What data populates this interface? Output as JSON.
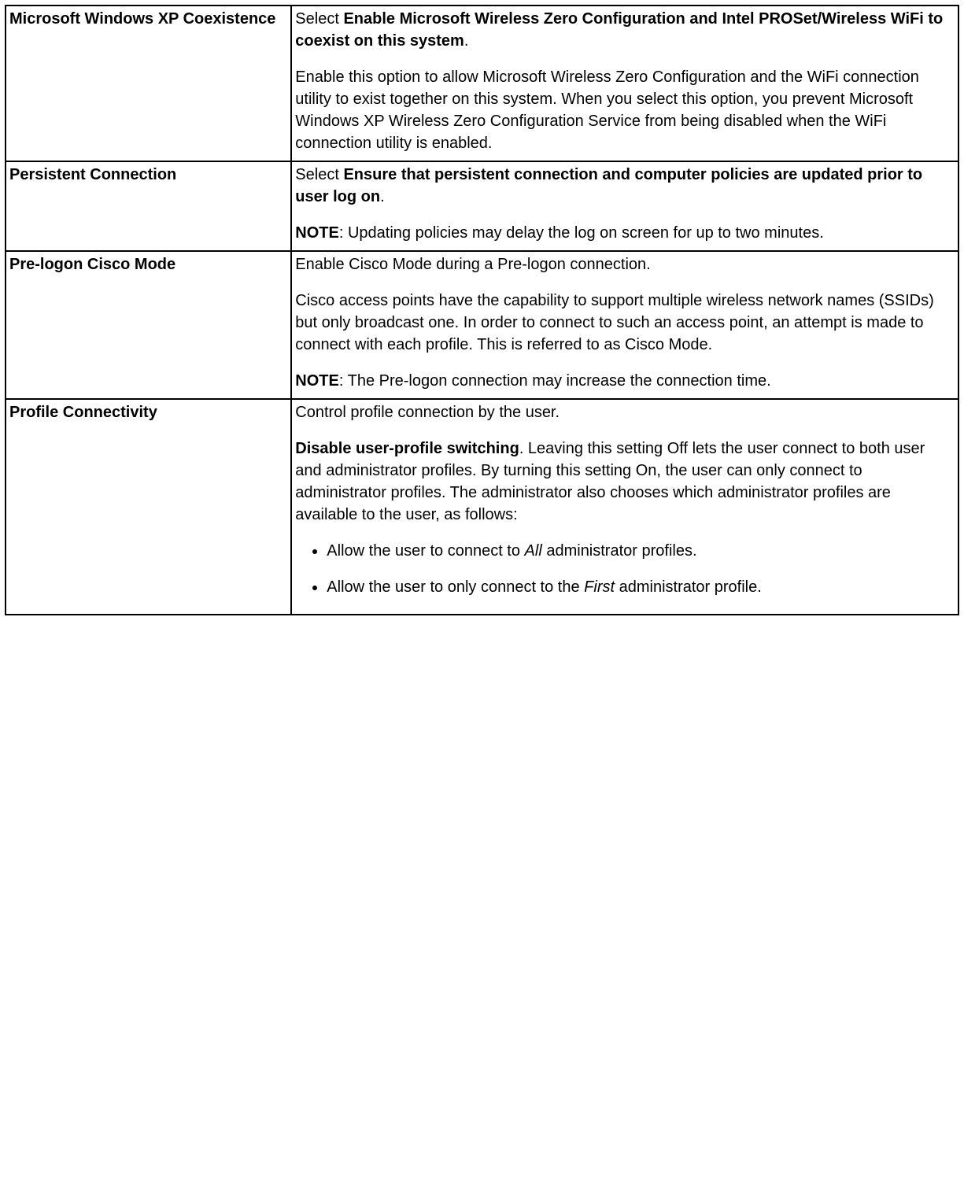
{
  "rows": [
    {
      "label": "Microsoft Windows XP Coexistence",
      "intro_pre": "Select ",
      "intro_bold": "Enable Microsoft Wireless Zero Configuration and Intel PROSet/Wireless WiFi to coexist on this system",
      "intro_post": ".",
      "body": "Enable this option to allow Microsoft Wireless Zero Configuration and the WiFi connection utility to exist together on this system. When you select this option, you prevent Microsoft Windows XP Wireless Zero Configuration Service from being disabled when the WiFi connection utility is enabled."
    },
    {
      "label": "Persistent Connection",
      "intro_pre": "Select ",
      "intro_bold": "Ensure that persistent connection and computer policies are updated prior to user log on",
      "intro_post": ".",
      "note_label": "NOTE",
      "note_text": ": Updating policies may delay the log on screen for up to two minutes."
    },
    {
      "label": "Pre-logon Cisco Mode",
      "intro_plain": "Enable Cisco Mode during a Pre-logon connection.",
      "body": "Cisco access points have the capability to support multiple wireless network names (SSIDs) but only broadcast one. In order to connect to such an access point, an attempt is made to connect with each profile. This is referred to as Cisco Mode.",
      "note_label": "NOTE",
      "note_text": ": The Pre-logon connection may increase the connection time."
    },
    {
      "label": "Profile Connectivity",
      "intro_plain": "Control profile connection by the user.",
      "body_bold": "Disable user-profile switching",
      "body_text": ". Leaving this setting Off lets the user connect to both user and administrator profiles. By turning this setting On, the user can only connect to administrator profiles. The administrator also chooses which administrator profiles are available to the user, as follows:",
      "items": [
        {
          "pre": "Allow the user to connect to ",
          "em": "All",
          "post": " administrator profiles."
        },
        {
          "pre": "Allow the user to only connect to the ",
          "em": "First",
          "post": " administrator profile."
        }
      ]
    }
  ]
}
